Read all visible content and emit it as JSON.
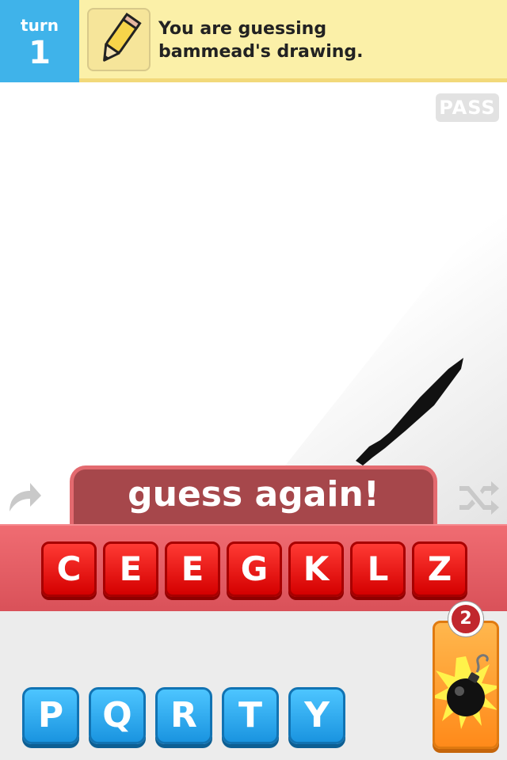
{
  "header": {
    "turn_label": "turn",
    "turn_number": "1",
    "message_line1": "You are guessing",
    "message_line2": "bammead's drawing.",
    "pencil_icon": "pencil-icon"
  },
  "canvas": {
    "pass_label": "PASS"
  },
  "side_icons": {
    "left": "redo-arrow-icon",
    "right": "shuffle-icon"
  },
  "guess": {
    "status": "guess again!",
    "answer_tiles": [
      "C",
      "E",
      "E",
      "G",
      "K",
      "L",
      "Z"
    ]
  },
  "letters": [
    "P",
    "Q",
    "R",
    "T",
    "Y"
  ],
  "bomb": {
    "count": "2",
    "icon": "bomb-icon"
  },
  "colors": {
    "turn_blue": "#3fb3ea",
    "header_yellow": "#fbf0a8",
    "answer_red": "#e60000",
    "letter_blue": "#2aa9f0",
    "bomb_orange": "#ff9f2e"
  }
}
